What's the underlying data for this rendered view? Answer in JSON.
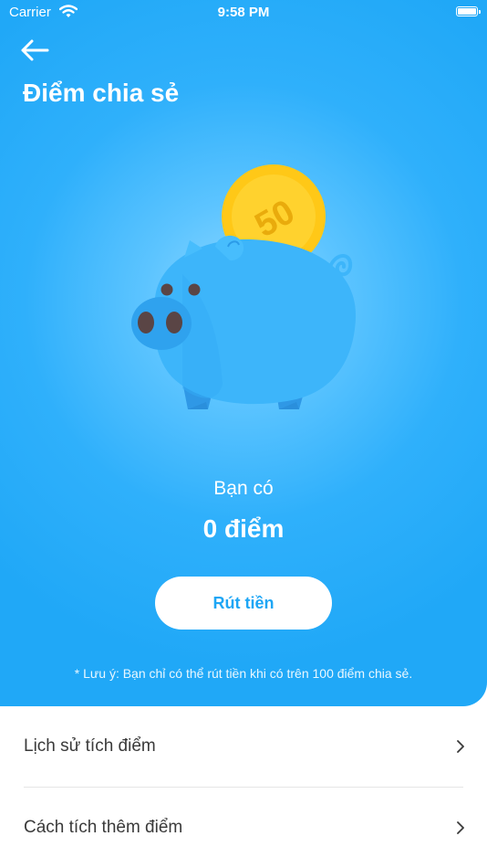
{
  "status_bar": {
    "carrier": "Carrier",
    "time": "9:58 PM"
  },
  "header": {
    "title": "Điểm chia sẻ",
    "back_icon": "arrow-left-icon"
  },
  "illustration": {
    "coin_value": "50"
  },
  "balance": {
    "label": "Bạn có",
    "value": "0 điểm"
  },
  "withdraw_button": {
    "label": "Rút tiền"
  },
  "note": "* Lưu ý: Bạn chỉ có thể rút tiền khi có trên 100 điểm chia sẻ.",
  "menu": {
    "items": [
      {
        "label": "Lịch sử tích điểm",
        "icon": "chevron-right-icon"
      },
      {
        "label": "Cách tích thêm điểm",
        "icon": "chevron-right-icon"
      }
    ]
  },
  "colors": {
    "primary": "#22A9F7",
    "coin": "#FFC817",
    "pig": "#3DB5FA",
    "white": "#FFFFFF"
  }
}
